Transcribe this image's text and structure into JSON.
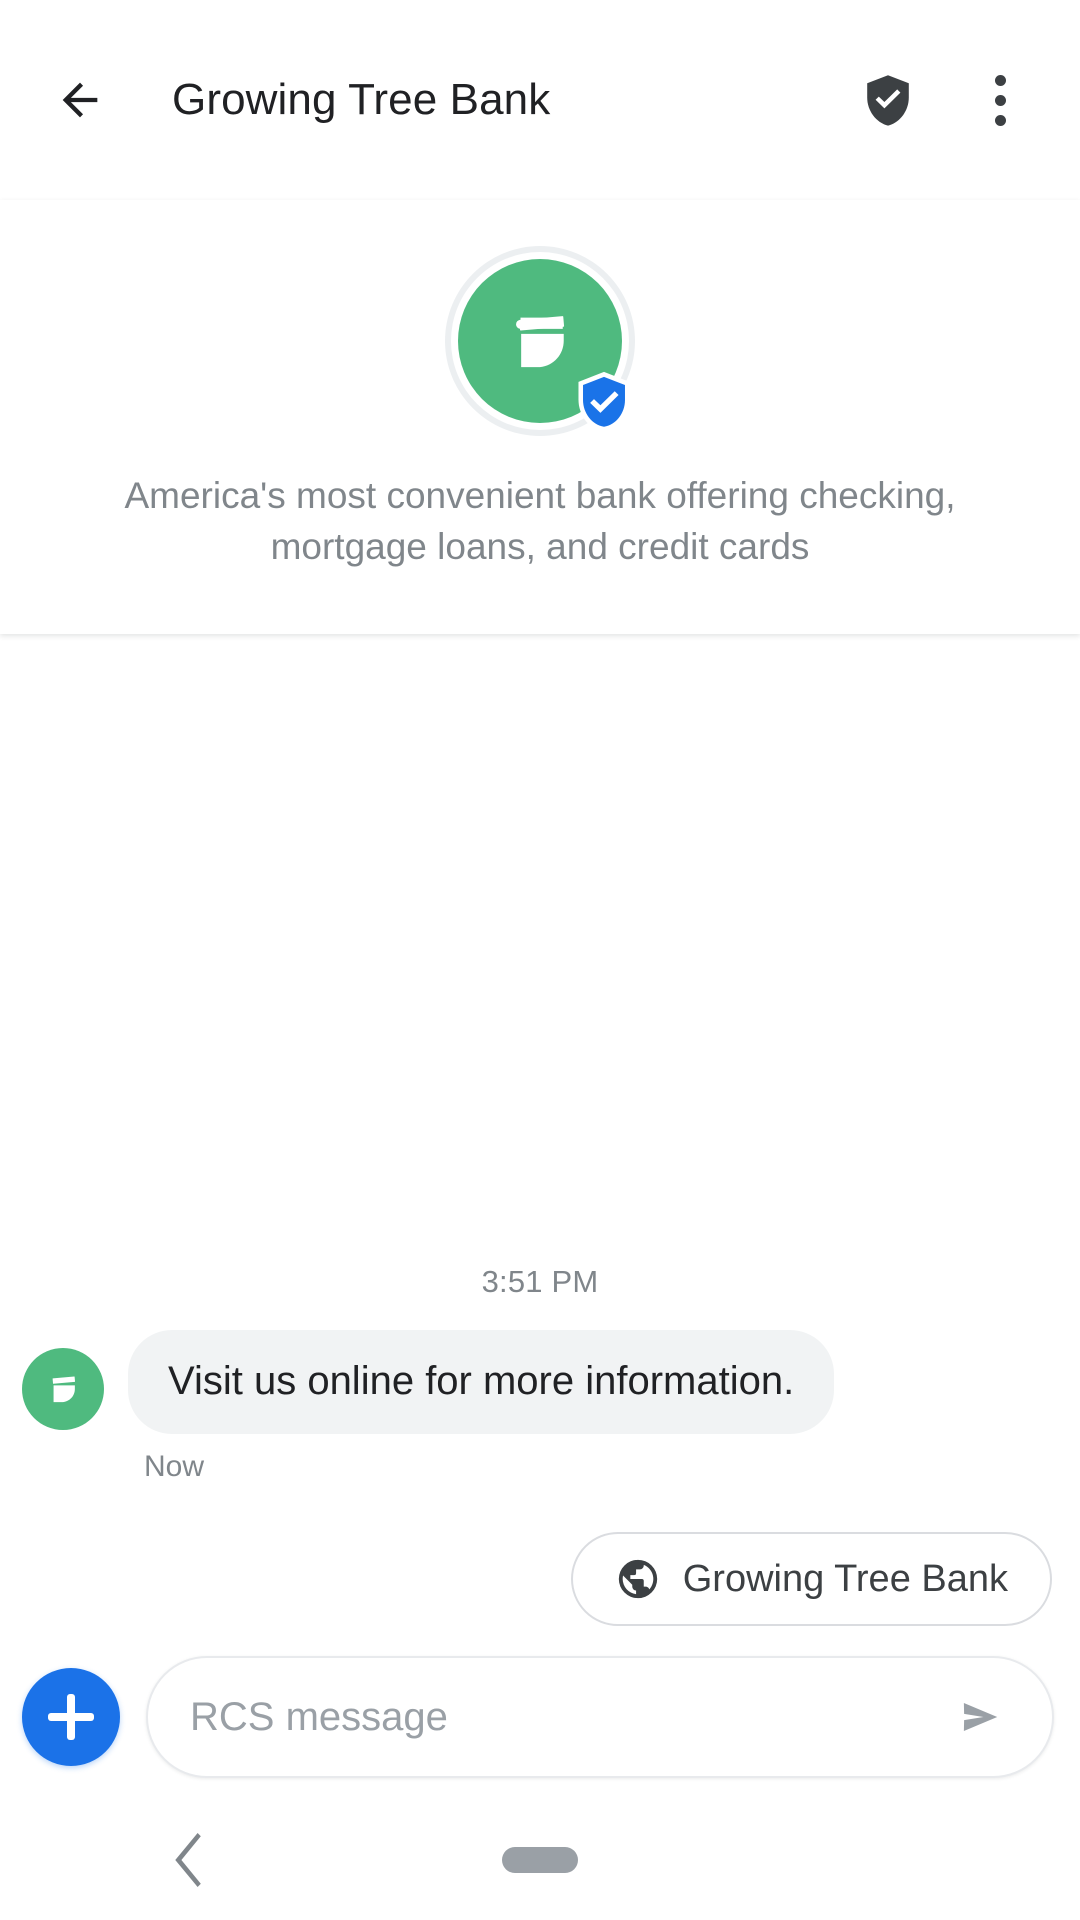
{
  "appbar": {
    "back_icon": "arrow-left-icon",
    "title": "Growing Tree Bank",
    "verified_icon": "verified-shield-icon",
    "overflow_icon": "more-vertical-icon"
  },
  "business": {
    "avatar_icon": "growing-tree-bank-leaf-logo",
    "verified_badge_icon": "verified-shield-badge-icon",
    "description": "America's most convenient bank offering checking, mortgage loans, and credit cards",
    "brand_color": "#4FBA7F",
    "verified_color": "#1A73E8"
  },
  "conversation": {
    "timestamp": "3:51 PM",
    "messages": [
      {
        "sender_avatar_icon": "growing-tree-bank-leaf-logo",
        "text": "Visit us online for more information.",
        "status": "Now"
      }
    ],
    "bubble_color": "#F1F3F4"
  },
  "suggestions": [
    {
      "icon": "globe-icon",
      "label": "Growing Tree Bank"
    }
  ],
  "composer": {
    "add_icon": "plus-icon",
    "placeholder": "RCS message",
    "value": "",
    "send_icon": "send-icon",
    "accent_color": "#1B72E8"
  },
  "navbar": {
    "back_icon": "chevron-left-icon",
    "home_icon": "home-pill-indicator"
  }
}
